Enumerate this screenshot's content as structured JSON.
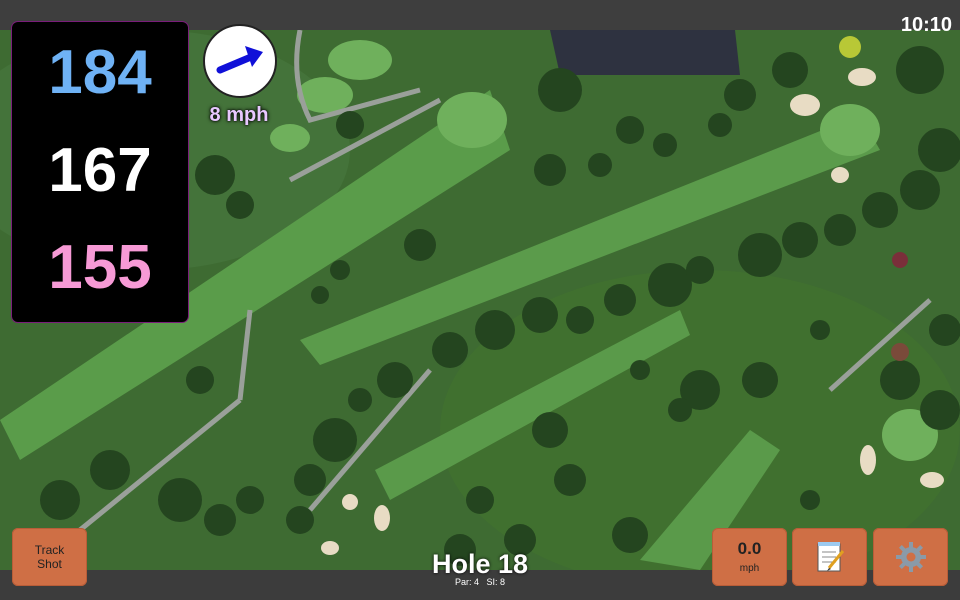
{
  "status": {
    "time": "10:10"
  },
  "yardages": {
    "back": "184",
    "middle": "167",
    "front": "155"
  },
  "wind": {
    "speed_label": "8 mph",
    "direction": "east-northeast"
  },
  "buttons": {
    "track_shot": "Track\nShot",
    "wind_value": "0.0",
    "wind_unit": "mph",
    "notes_icon": "notepad-icon",
    "settings_icon": "gear-icon"
  },
  "hole": {
    "title": "Hole 18",
    "par": "Par: 4",
    "si": "SI: 8"
  },
  "colors": {
    "back": "#6fb2f5",
    "middle": "#ffffff",
    "front": "#f79ad6",
    "button": "#cf6f45"
  }
}
